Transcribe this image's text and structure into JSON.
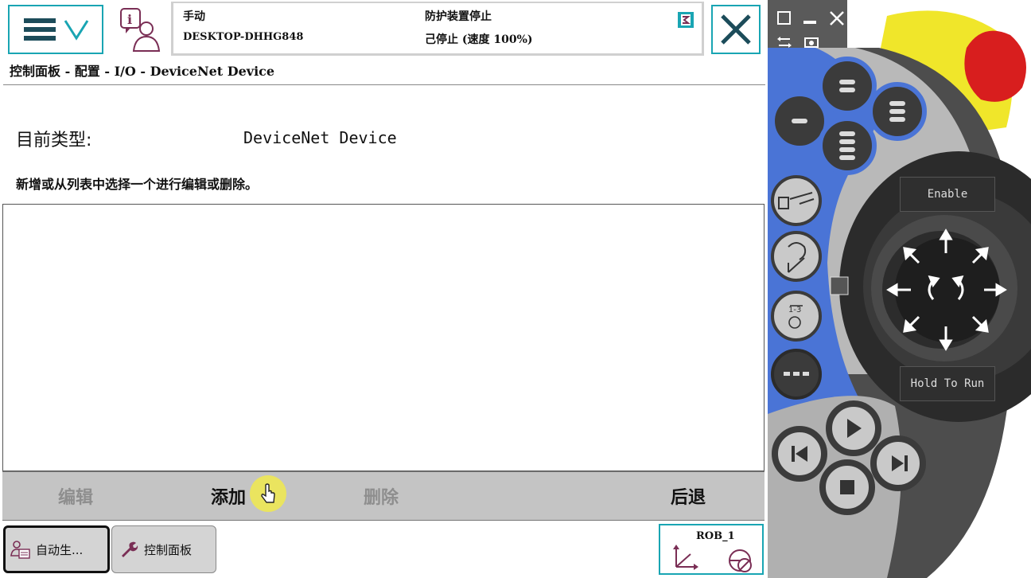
{
  "header": {
    "mode": "手动",
    "system_name": "DESKTOP-DHHG848",
    "safety_status": "防护装置停止",
    "run_status": "己停止 (速度 100%)"
  },
  "breadcrumb": "控制面板 - 配置 - I/O - DeviceNet Device",
  "type_label": "目前类型:",
  "type_value": "DeviceNet Device",
  "hint": "新增或从列表中选择一个进行编辑或删除。",
  "actions": {
    "edit": "编辑",
    "add": "添加",
    "delete": "删除",
    "back": "后退"
  },
  "taskbar": {
    "task1": "自动生...",
    "task2": "控制面板",
    "rob": "ROB_1"
  },
  "device": {
    "enable_label": "Enable",
    "hold_to_run_label": "Hold To Run"
  },
  "colors": {
    "accent": "#19a5b3",
    "device_blue": "#4a74d6",
    "emergency_red": "#d81e1e",
    "yellow": "#f0e62a",
    "cursor_highlight": "#eae45f"
  }
}
